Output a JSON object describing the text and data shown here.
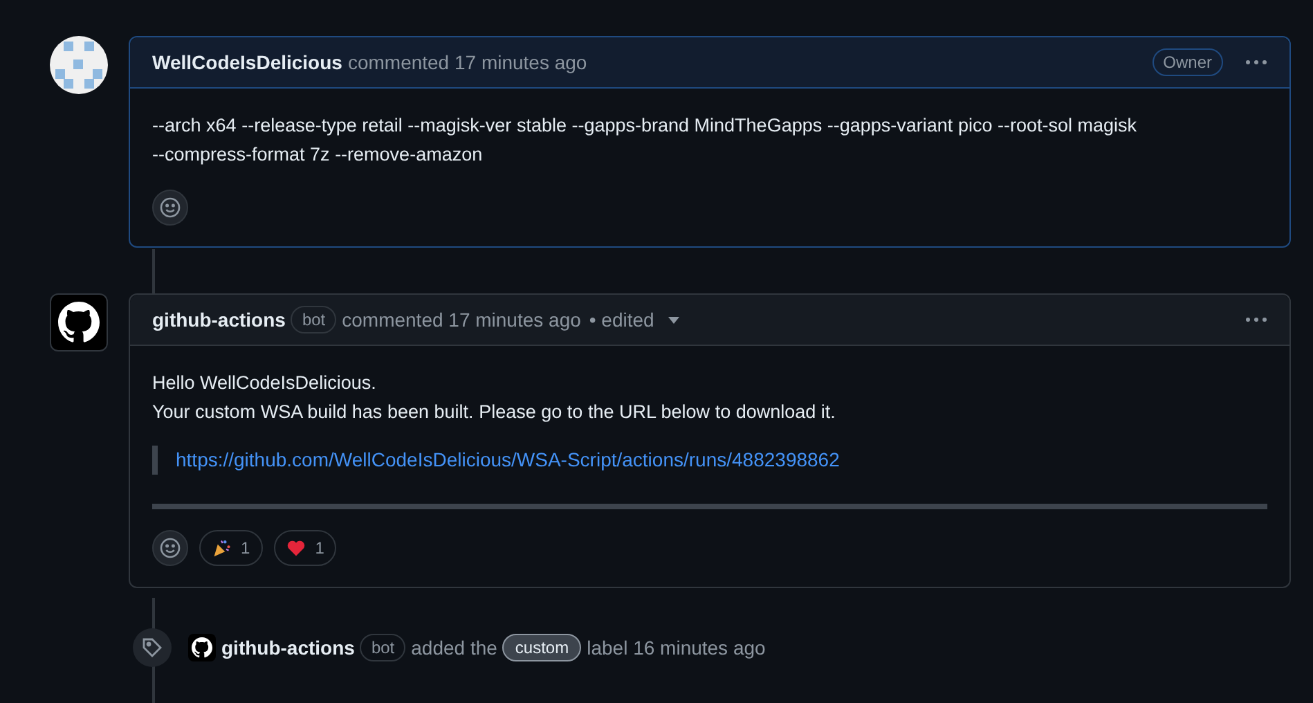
{
  "comments": [
    {
      "kind": "identicon",
      "highlighted": true,
      "author": "WellCodeIsDelicious",
      "action": "commented",
      "time": "17 minutes ago",
      "role_badge": "Owner",
      "body": [
        "--arch x64 --release-type retail --magisk-ver stable --gapps-brand MindTheGapps --gapps-variant pico --root-sol magisk --compress-format 7z --remove-amazon"
      ]
    },
    {
      "kind": "github",
      "highlighted": false,
      "author": "github-actions",
      "author_badge": "bot",
      "action": "commented",
      "time": "17 minutes ago",
      "edited": "• edited",
      "body": [
        "Hello WellCodeIsDelicious.",
        "Your custom WSA build has been built. Please go to the URL below to download it."
      ],
      "quote_link": "https://github.com/WellCodeIsDelicious/WSA-Script/actions/runs/4882398862",
      "reactions": [
        {
          "kind": "party",
          "count": "1"
        },
        {
          "kind": "heart",
          "count": "1"
        }
      ]
    }
  ],
  "event": {
    "actor": "github-actions",
    "actor_badge": "bot",
    "text": "added the",
    "label": "custom",
    "suffix": "label 16 minutes ago"
  }
}
